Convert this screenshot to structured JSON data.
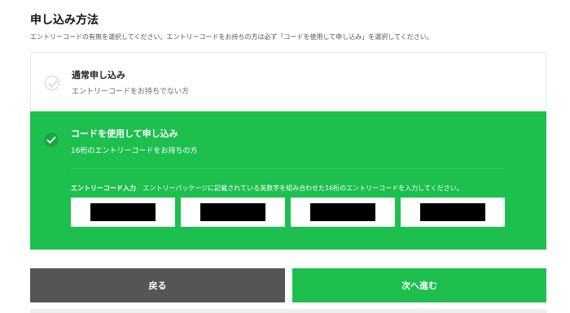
{
  "page": {
    "title": "申し込み方法",
    "description": "エントリーコードの有無を選択してください。エントリーコードをお持ちの方は必ず「コードを使用して申し込み」を選択してください。"
  },
  "options": [
    {
      "title": "通常申し込み",
      "subtitle": "エントリーコードをお持ちでない方",
      "selected": false
    },
    {
      "title": "コードを使用して申し込み",
      "subtitle": "16桁のエントリーコードをお持ちの方",
      "selected": true
    }
  ],
  "entry_code": {
    "label": "エントリーコード入力",
    "instruction": "エントリーパッケージに記載されている英数字を組み合わせた16桁のエントリーコードを入力してください。",
    "field_count": 4
  },
  "buttons": {
    "back_label": "戻る",
    "next_label": "次へ進む"
  },
  "colors": {
    "accent_green": "#1dbf4f",
    "back_button": "#555555"
  },
  "icons": {
    "check": "check-icon"
  }
}
